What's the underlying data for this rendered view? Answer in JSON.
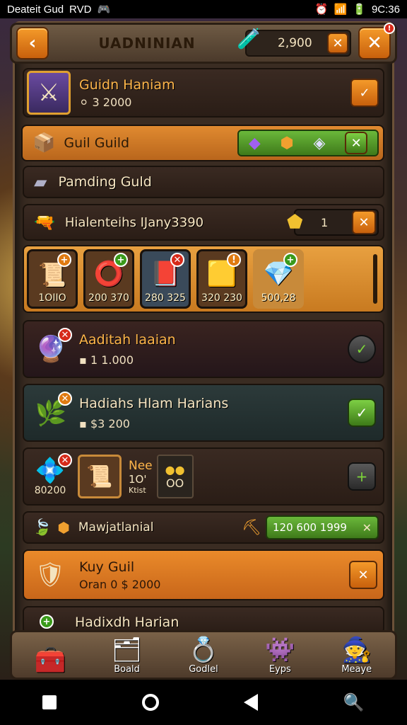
{
  "status": {
    "left1": "Deateit Gud",
    "left2": "RVD",
    "time": "9C:36"
  },
  "header": {
    "title": "UADNINIAN",
    "currency_value": "2,900"
  },
  "guild_row": {
    "title": "Guidn Haniam",
    "value": "3 2000"
  },
  "guild_bar": {
    "title": "Guil Guild"
  },
  "pending": {
    "title": "Pamding Guld"
  },
  "member_row": {
    "title": "Hialenteihs IJany3390",
    "count": "1"
  },
  "items": [
    {
      "label": "1OIIO"
    },
    {
      "label": "200 370"
    },
    {
      "label": "280 325"
    },
    {
      "label": "320 230"
    },
    {
      "label": "500,28"
    }
  ],
  "card1": {
    "title": "Aaditah laaian",
    "value": "1 1.000"
  },
  "card2": {
    "title": "Hadiahs Hlam Harians",
    "value": "$3 200"
  },
  "card3": {
    "gem_value": "80200",
    "label1": "Nee",
    "label2": "1O'",
    "label3": "Ktist",
    "value": "OO"
  },
  "mawja": {
    "title": "Mawjatlanial",
    "bar_value": "120 600 1999"
  },
  "kuy": {
    "title": "Kuy Guil",
    "value": "Oran 0 $ 2000"
  },
  "last": {
    "title": "Hadixdh Harian"
  },
  "nav": [
    {
      "label": ""
    },
    {
      "label": "Boald"
    },
    {
      "label": "Godlel"
    },
    {
      "label": "Eyps"
    },
    {
      "label": "Meaye"
    }
  ]
}
